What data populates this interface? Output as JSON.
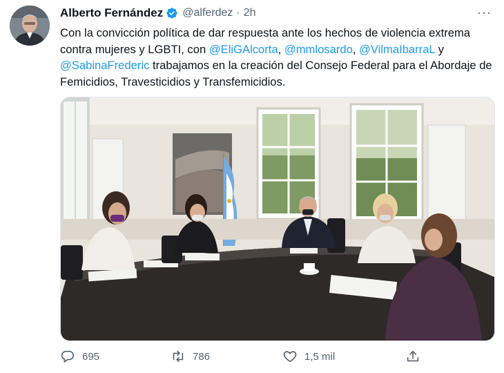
{
  "tweet": {
    "author_name": "Alberto Fernández",
    "handle": "@alferdez",
    "separator": "·",
    "time": "2h",
    "more": "···",
    "text": {
      "part1": "Con la convicción política de dar respuesta ante los hechos de violencia extrema contra mujeres y LGBTI, con ",
      "mention1": "@EliGAlcorta",
      "sep1": ", ",
      "mention2": "@mmlosardo",
      "sep2": ", ",
      "mention3": "@VilmaIbarraL",
      "sep3": " y ",
      "mention4": "@SabinaFrederic",
      "part2": " trabajamos en la creación del Consejo Federal para el Abordaje de Femicidios, Travesticidios y Transfemicidios."
    }
  },
  "actions": {
    "replies": "695",
    "retweets": "786",
    "likes": "1,5 mil"
  },
  "colors": {
    "link": "#1d9bf0",
    "text": "#0f1419",
    "muted": "#536471",
    "verified": "#1d9bf0"
  },
  "icons": {
    "verified": "verified-badge-icon",
    "reply": "reply-icon",
    "retweet": "retweet-icon",
    "like": "heart-icon",
    "share": "share-icon",
    "more": "more-icon"
  }
}
